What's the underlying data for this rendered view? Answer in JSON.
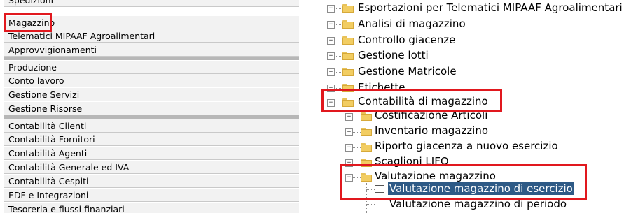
{
  "left_menu": {
    "items": [
      "Spedizioni",
      "Magazzino",
      "Telematici MIPAAF Agroalimentari",
      "Approvvigionamenti",
      "Produzione",
      "Conto lavoro",
      "Gestione Servizi",
      "Gestione Risorse",
      "Contabilità Clienti",
      "Contabilità Fornitori",
      "Contabilità Agenti",
      "Contabilità Generale ed IVA",
      "Contabilità Cespiti",
      "EDF e Integrazioni",
      "Tesoreria e flussi finanziari"
    ]
  },
  "tree": {
    "nodes": [
      "Esportazioni per Telematici MIPAAF Agroalimentari",
      "Analisi di magazzino",
      "Controllo giacenze",
      "Gestione lotti",
      "Gestione Matricole",
      "Etichette",
      "Contabilità di magazzino",
      "Costificazione Articoli",
      "Inventario magazzino",
      "Riporto giacenza a nuovo esercizio",
      "Scaglioni LIFO",
      "Valutazione magazzino",
      "Valutazione magazzino di esercizio",
      "Valutazione magazzino di periodo"
    ]
  },
  "colors": {
    "highlight": "#e1181e",
    "selection": "#2e5a86",
    "folder": "#f2cd62"
  }
}
